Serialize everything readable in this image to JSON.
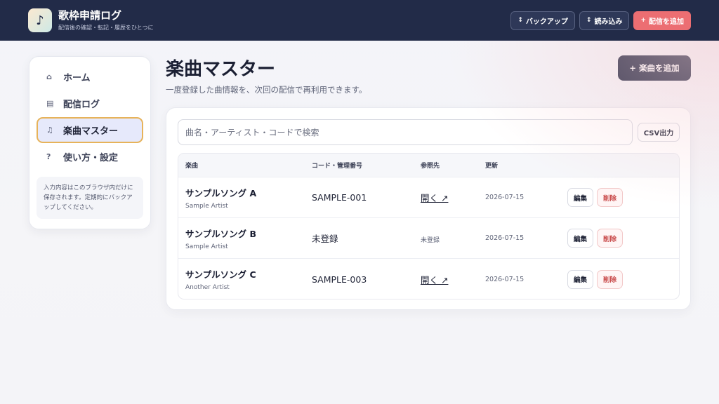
{
  "header": {
    "logo_glyph": "♪",
    "title": "歌枠申請ログ",
    "subtitle": "配信後の確認・転記・履歴をひとつに",
    "buttons": [
      {
        "icon": "↕",
        "label": "バックアップ"
      },
      {
        "icon": "↕",
        "label": "読み込み"
      },
      {
        "icon": "+",
        "label": "配信を追加"
      }
    ]
  },
  "sidebar": {
    "items": [
      {
        "icon": "⌂",
        "label": "ホーム"
      },
      {
        "icon": "▤",
        "label": "配信ログ"
      },
      {
        "icon": "♫",
        "label": "楽曲マスター"
      },
      {
        "icon": "?",
        "label": "使い方・設定"
      }
    ],
    "note": "入力内容はこのブラウザ内だけに保存されます。定期的にバックアップしてください。"
  },
  "main": {
    "title": "楽曲マスター",
    "description": "一度登録した曲情報を、次回の配信で再利用できます。",
    "add_button": {
      "icon": "+",
      "label": "楽曲を追加"
    },
    "search_placeholder": "曲名・アーティスト・コードで検索",
    "csv_label": "CSV出力",
    "table": {
      "headers": [
        "楽曲",
        "コード・管理番号",
        "参照先",
        "更新"
      ],
      "rows": [
        {
          "title": "サンプルソング A",
          "artist": "Sample Artist",
          "code": "SAMPLE-001",
          "ref": "開く ↗",
          "updated": "2026-07-15",
          "edit": "編集",
          "delete": "削除"
        },
        {
          "title": "サンプルソング B",
          "artist": "Sample Artist",
          "code": "未登録",
          "ref": "未登録",
          "updated": "2026-07-15",
          "edit": "編集",
          "delete": "削除"
        },
        {
          "title": "サンプルソング C",
          "artist": "Another Artist",
          "code": "SAMPLE-003",
          "ref": "開く ↗",
          "updated": "2026-07-15",
          "edit": "編集",
          "delete": "削除"
        }
      ]
    }
  },
  "colors": {
    "header_bg": "#222b48",
    "accent": "#ec6e72",
    "active_border": "#e7b35a",
    "active_bg": "#e6e9fb",
    "delete": "#c94a4a"
  }
}
